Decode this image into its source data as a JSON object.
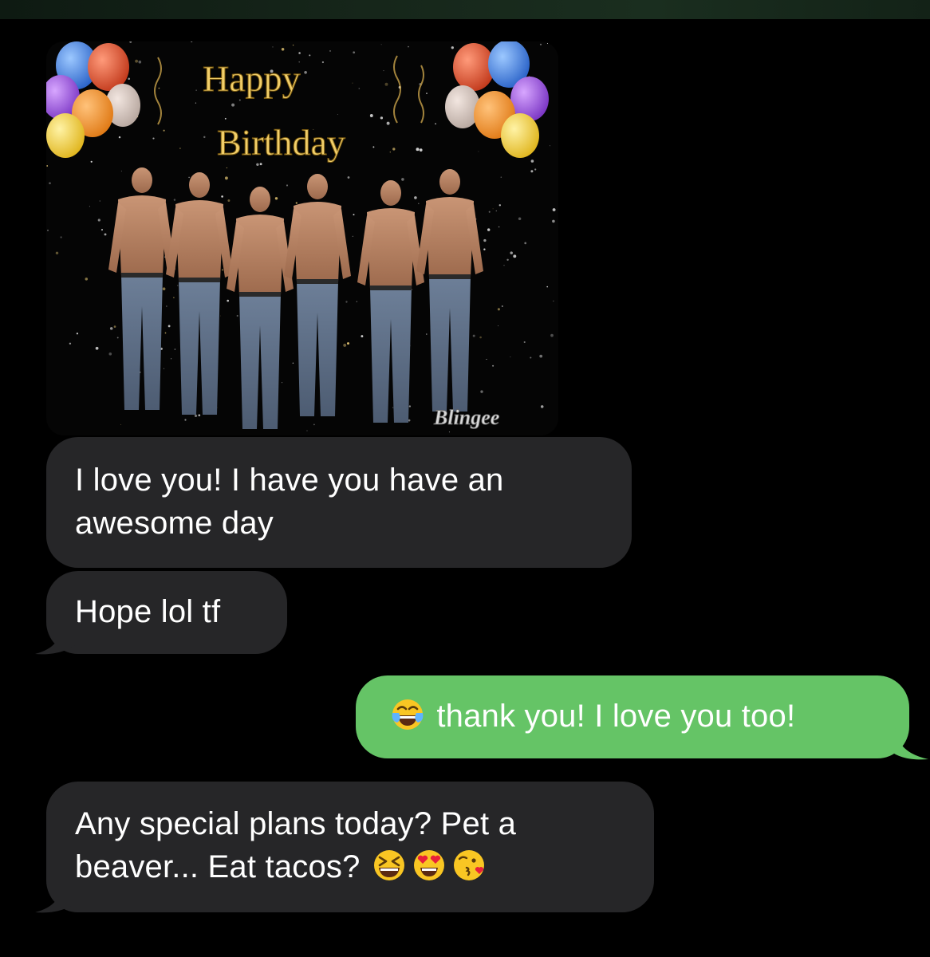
{
  "gif": {
    "title_line1": "Happy",
    "title_line2": "Birthday",
    "watermark": "Blingee"
  },
  "messages": [
    {
      "direction": "incoming",
      "text": "I love you! I have you have an\nawesome day"
    },
    {
      "direction": "incoming",
      "text": "Hope lol tf"
    },
    {
      "direction": "outgoing",
      "emoji_before": "face-with-tears-of-joy",
      "text": "thank you! I love you too!"
    },
    {
      "direction": "incoming",
      "text": "Any special plans today? Pet a\nbeaver... Eat tacos?",
      "emoji_after": [
        "grinning-squinting-face",
        "smiling-face-with-heart-eyes",
        "face-blowing-a-kiss"
      ]
    }
  ],
  "colors": {
    "background": "#000000",
    "incoming_bubble": "#262628",
    "outgoing_bubble": "#65c466",
    "text": "#ffffff"
  }
}
